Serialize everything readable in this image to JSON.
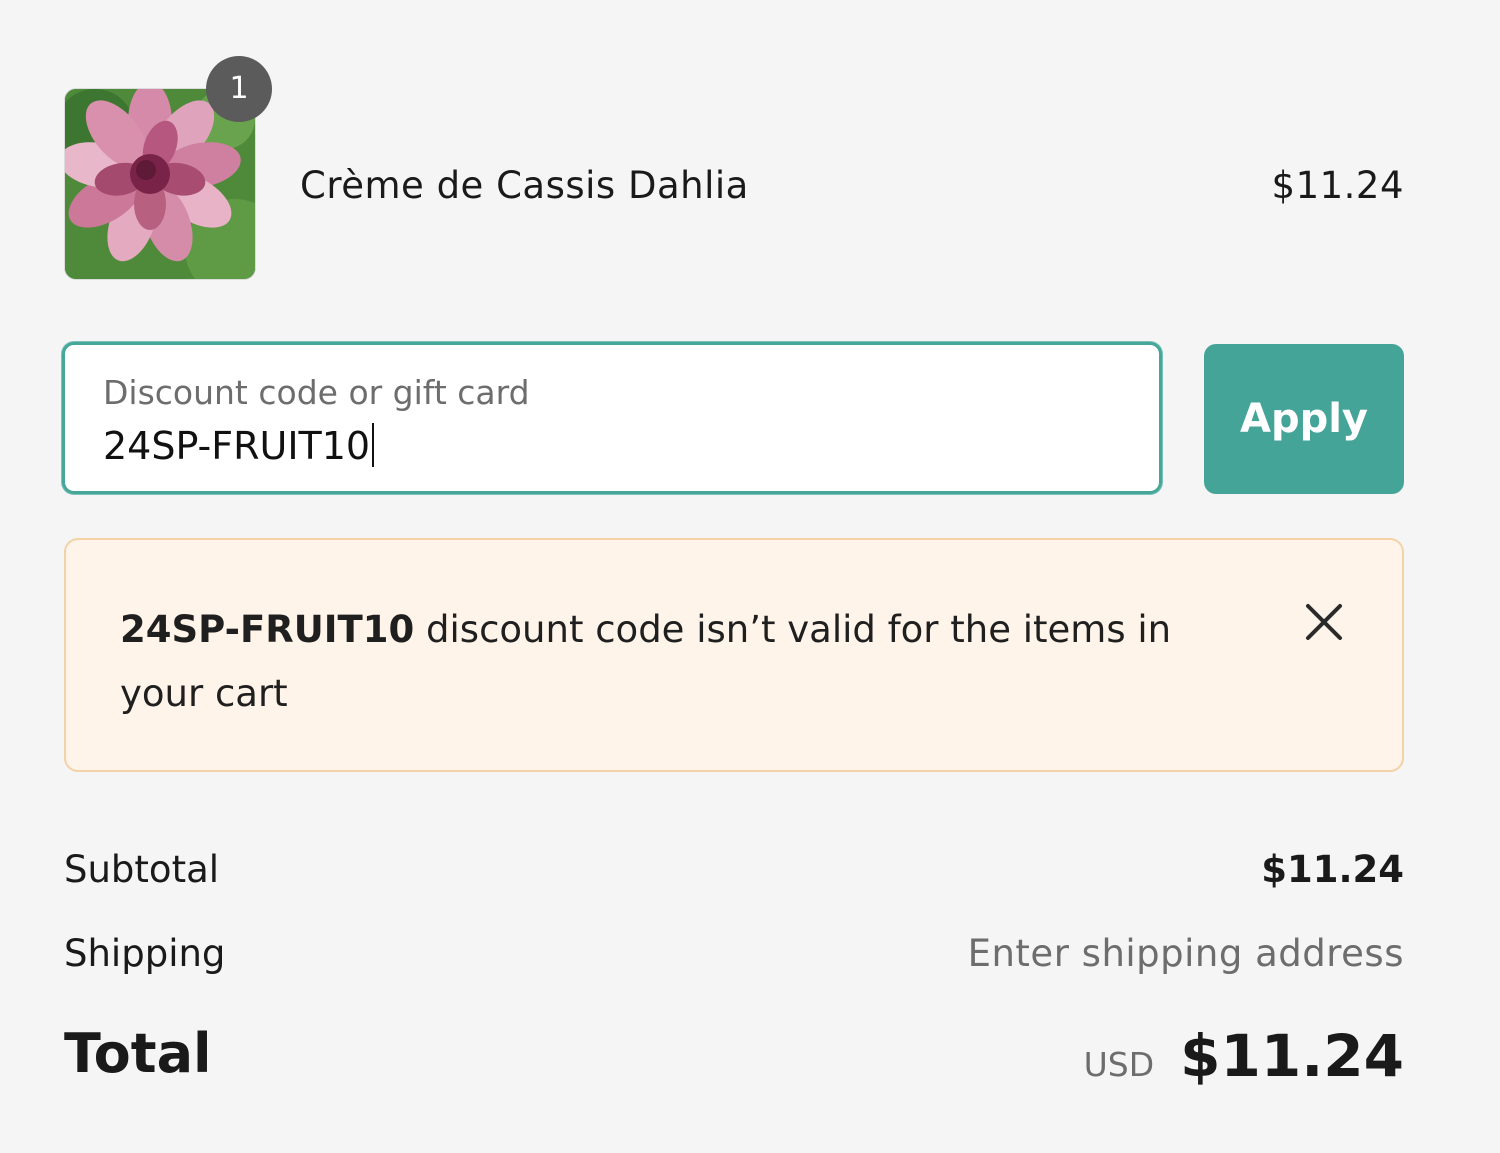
{
  "cart_item": {
    "quantity": "1",
    "name": "Crème de Cassis Dahlia",
    "price": "$11.24"
  },
  "discount": {
    "label": "Discount code or gift card",
    "value": "24SP-FRUIT10",
    "apply_label": "Apply"
  },
  "error": {
    "code": "24SP-FRUIT10",
    "message": " discount code isn’t valid for the items in your cart"
  },
  "summary": {
    "subtotal_label": "Subtotal",
    "subtotal_value": "$11.24",
    "shipping_label": "Shipping",
    "shipping_value": "Enter shipping address",
    "total_label": "Total",
    "currency": "USD",
    "total_value": "$11.24"
  },
  "colors": {
    "accent": "#44a497",
    "background": "#f5f5f5",
    "warning_bg": "#fff4e9",
    "warning_border": "#f3d2a8"
  }
}
